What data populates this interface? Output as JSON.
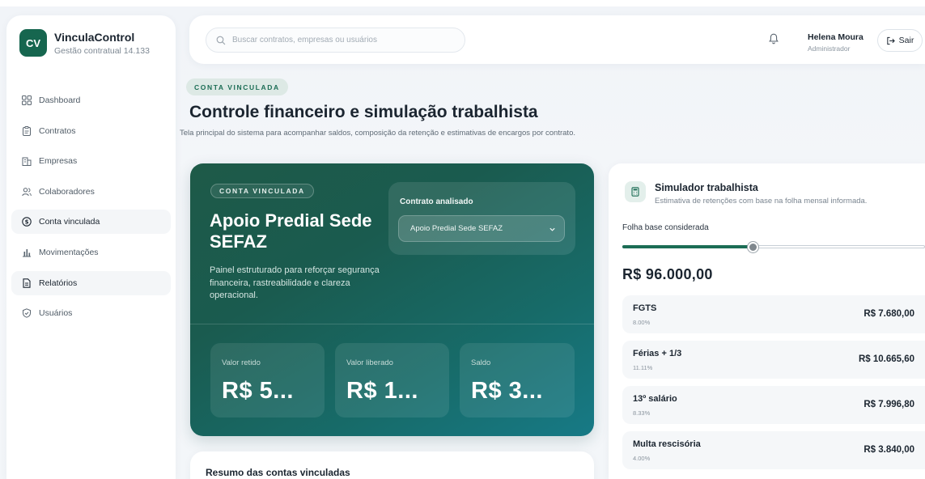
{
  "brand": {
    "logo": "CV",
    "name": "VinculaControl",
    "subtitle": "Gestão contratual 14.133"
  },
  "sidebar": {
    "items": [
      {
        "label": "Dashboard",
        "icon": "grid-icon"
      },
      {
        "label": "Contratos",
        "icon": "clipboard-icon"
      },
      {
        "label": "Empresas",
        "icon": "building-icon"
      },
      {
        "label": "Colaboradores",
        "icon": "users-icon"
      },
      {
        "label": "Conta vinculada",
        "icon": "coin-icon",
        "active": true
      },
      {
        "label": "Movimentações",
        "icon": "bar-chart-icon"
      },
      {
        "label": "Relatórios",
        "icon": "report-icon"
      },
      {
        "label": "Usuários",
        "icon": "shield-icon"
      }
    ]
  },
  "topbar": {
    "search_placeholder": "Buscar contratos, empresas ou usuários",
    "user_name": "Helena Moura",
    "user_role": "Administrador",
    "logout_label": "Sair"
  },
  "header": {
    "eyebrow": "CONTA VINCULADA",
    "title": "Controle financeiro e simulação trabalhista",
    "description": "Tela principal do sistema para acompanhar saldos, composição da retenção e estimativas de encargos por contrato."
  },
  "hero": {
    "eyebrow": "CONTA VINCULADA",
    "title": "Apoio Predial Sede SEFAZ",
    "description": "Painel estruturado para reforçar segurança financeira, rastreabilidade e clareza operacional.",
    "contract_label": "Contrato analisado",
    "contract_selected": "Apoio Predial Sede SEFAZ",
    "metrics": [
      {
        "label": "Valor retido",
        "value": "R$ 5..."
      },
      {
        "label": "Valor liberado",
        "value": "R$ 1..."
      },
      {
        "label": "Saldo",
        "value": "R$ 3..."
      }
    ]
  },
  "summary": {
    "title": "Resumo das contas vinculadas"
  },
  "simulator": {
    "title": "Simulador trabalhista",
    "subtitle": "Estimativa de retenções com base na folha mensal informada.",
    "folha_label": "Folha base considerada",
    "slider_fraction": 0.43,
    "folha_value": "R$ 96.000,00",
    "encargos": [
      {
        "name": "FGTS",
        "rate": "8.00%",
        "value": "R$ 7.680,00"
      },
      {
        "name": "Férias + 1/3",
        "rate": "11.11%",
        "value": "R$ 10.665,60"
      },
      {
        "name": "13º salário",
        "rate": "8.33%",
        "value": "R$ 7.996,80"
      },
      {
        "name": "Multa rescisória",
        "rate": "4.00%",
        "value": "R$ 3.840,00"
      }
    ]
  },
  "colors": {
    "brand_green": "#16664f",
    "accent": "#1c6d55",
    "hero_start": "#1e5a48",
    "hero_end": "#177a86"
  }
}
